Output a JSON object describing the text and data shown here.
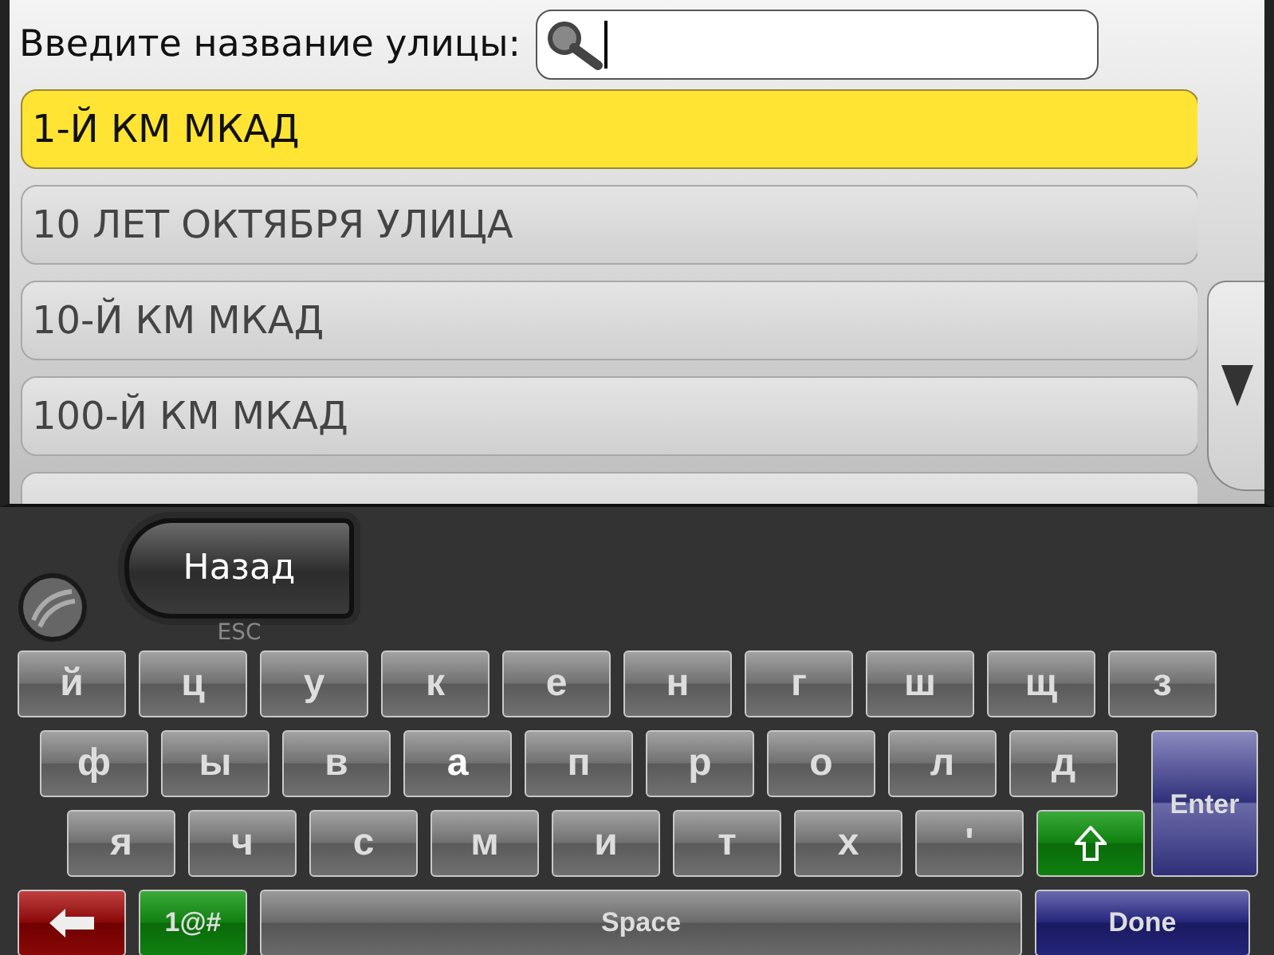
{
  "search": {
    "label": "Введите название улицы:"
  },
  "results": [
    {
      "name": "1-Й КМ МКАД",
      "selected": true
    },
    {
      "name": "10 ЛЕТ ОКТЯБРЯ УЛИЦА",
      "selected": false
    },
    {
      "name": "10-Й КМ МКАД",
      "selected": false
    },
    {
      "name": "100-Й КМ МКАД",
      "selected": false
    }
  ],
  "back_button": {
    "label": "Назад",
    "hint": "ESC"
  },
  "keyboard": {
    "row_1": [
      {
        "label": "й",
        "highlighted": false
      },
      {
        "label": "ц",
        "highlighted": false
      },
      {
        "label": "у",
        "highlighted": false
      },
      {
        "label": "к",
        "highlighted": false
      },
      {
        "label": "е",
        "highlighted": false
      },
      {
        "label": "н",
        "highlighted": false
      },
      {
        "label": "г",
        "highlighted": false
      },
      {
        "label": "ш",
        "highlighted": false
      },
      {
        "label": "щ",
        "highlighted": false
      },
      {
        "label": "з",
        "highlighted": false
      }
    ],
    "row_2": [
      {
        "label": "ф",
        "highlighted": false
      },
      {
        "label": "ы",
        "highlighted": false
      },
      {
        "label": "в",
        "highlighted": false
      },
      {
        "label": "а",
        "highlighted": true
      },
      {
        "label": "п",
        "highlighted": false
      },
      {
        "label": "р",
        "highlighted": false
      },
      {
        "label": "о",
        "highlighted": false
      },
      {
        "label": "л",
        "highlighted": false
      },
      {
        "label": "д",
        "highlighted": false
      }
    ],
    "row_3": [
      {
        "kind": "letter",
        "label": "я"
      },
      {
        "kind": "letter",
        "label": "ч"
      },
      {
        "kind": "letter",
        "label": "с"
      },
      {
        "kind": "letter",
        "label": "м"
      },
      {
        "kind": "letter",
        "label": "и"
      },
      {
        "kind": "letter",
        "label": "т"
      },
      {
        "kind": "letter",
        "label": "х"
      },
      {
        "kind": "letter",
        "label": "'"
      },
      {
        "kind": "shift"
      }
    ],
    "enter": "Enter",
    "bottom_row": [
      {
        "kind": "backspace"
      },
      {
        "kind": "symbols",
        "label": "1@#"
      },
      {
        "kind": "space",
        "label": "Space"
      },
      {
        "kind": "done",
        "label": "Done"
      }
    ]
  }
}
